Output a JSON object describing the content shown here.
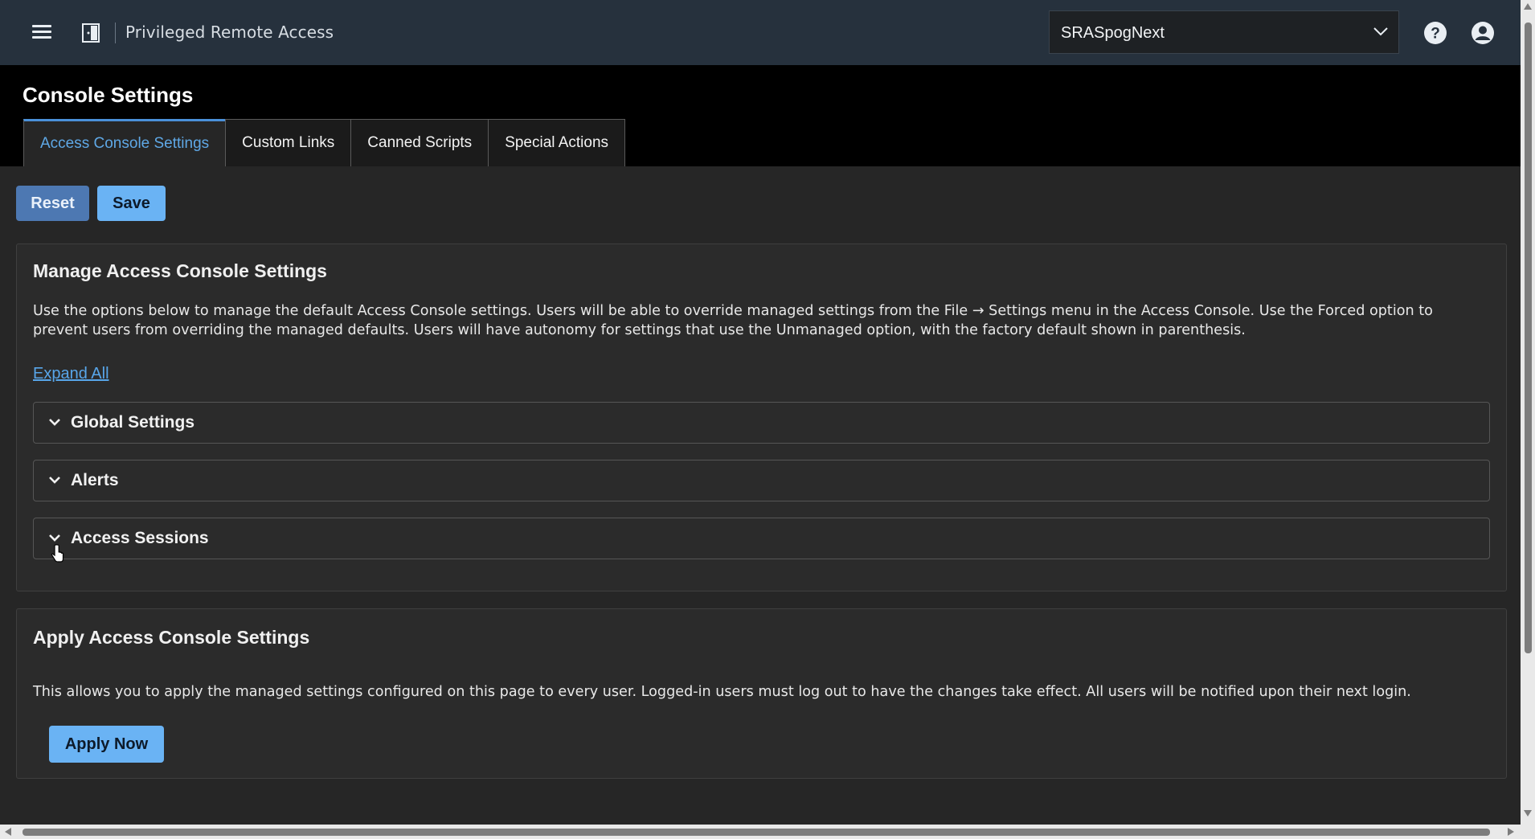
{
  "topbar": {
    "app_title": "Privileged Remote Access",
    "site_select_value": "SRASpogNext"
  },
  "page": {
    "title": "Console Settings",
    "tabs": [
      {
        "label": "Access Console Settings",
        "active": true
      },
      {
        "label": "Custom Links",
        "active": false
      },
      {
        "label": "Canned Scripts",
        "active": false
      },
      {
        "label": "Special Actions",
        "active": false
      }
    ]
  },
  "actions": {
    "reset_label": "Reset",
    "save_label": "Save"
  },
  "manage": {
    "title": "Manage Access Console Settings",
    "description": "Use the options below to manage the default Access Console settings. Users will be able to override managed settings from the File → Settings menu in the Access Console. Use the Forced option to prevent users from overriding the managed defaults. Users will have autonomy for settings that use the Unmanaged option, with the factory default shown in parenthesis.",
    "expand_all_label": "Expand All",
    "sections": [
      {
        "label": "Global Settings"
      },
      {
        "label": "Alerts"
      },
      {
        "label": "Access Sessions"
      }
    ]
  },
  "apply": {
    "title": "Apply Access Console Settings",
    "description": "This allows you to apply the managed settings configured on this page to every user. Logged-in users must log out to have the changes take effect. All users will be notified upon their next login.",
    "button_label": "Apply Now"
  },
  "icons": {
    "menu": "hamburger-menu-icon",
    "logo": "app-logo-icon",
    "dropdown": "chevron-down-icon",
    "help": "help-icon",
    "user": "user-account-icon"
  },
  "colors": {
    "topbar": "#26313d",
    "primary_button": "#6ab3f4",
    "secondary_button": "#4d78b2",
    "active_tab_text": "#5fa8e6",
    "link": "#58a6ea"
  }
}
